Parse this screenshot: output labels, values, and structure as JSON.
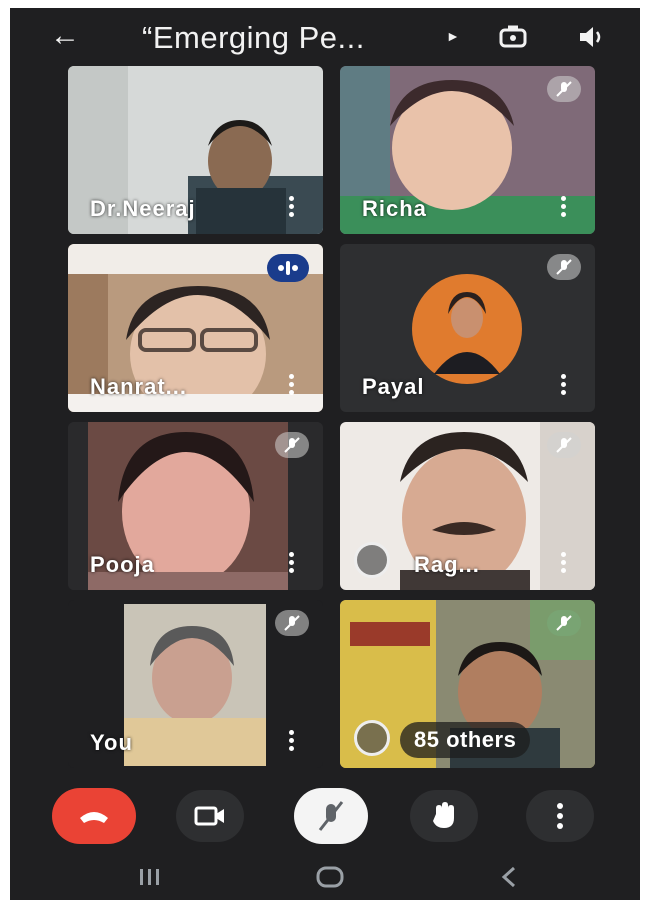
{
  "meeting": {
    "title": "“Emerging Pe...",
    "colors": {
      "background": "#1f1f21",
      "leave_red": "#ea4335",
      "active_speaker": "#1a3c8c"
    }
  },
  "participants": [
    {
      "name": "Dr.Neeraj",
      "mic_muted": false
    },
    {
      "name": "Richa",
      "mic_muted": true
    },
    {
      "name": "Nanrat...",
      "mic_muted": false,
      "speaking": true
    },
    {
      "name": "Payal",
      "mic_muted": true
    },
    {
      "name": "Pooja",
      "mic_muted": true
    },
    {
      "name": "Rag...",
      "mic_muted": true
    },
    {
      "name": "You",
      "mic_muted": true
    }
  ],
  "others_tile": {
    "label": "85 others"
  },
  "controls": [
    "leave-call",
    "camera",
    "microphone-muted",
    "raise-hand",
    "more-options"
  ],
  "system_nav": [
    "recent-apps",
    "home",
    "back"
  ]
}
